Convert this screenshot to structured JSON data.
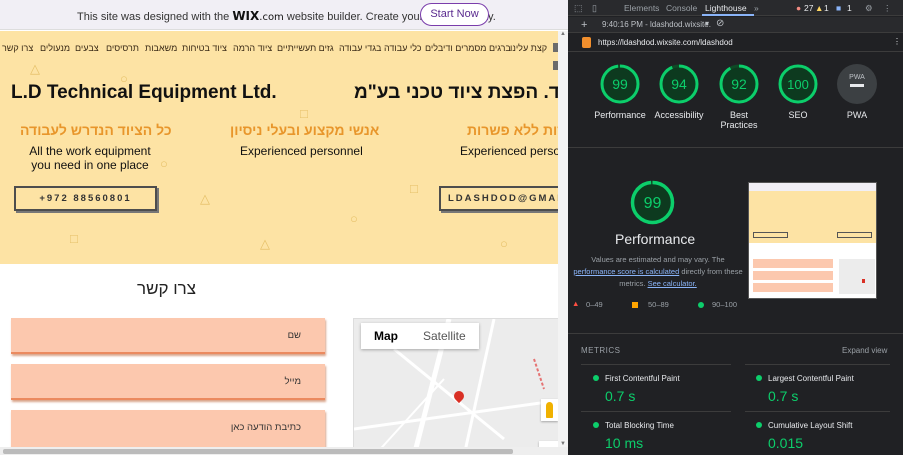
{
  "wix_banner": {
    "message_pre": "This site was designed with the",
    "brand": "WIX",
    "brand_suffix": ".com",
    "message_post": "website builder. Create your website today.",
    "cta": "Start Now"
  },
  "site": {
    "nav_items": [
      "צרו קשר",
      "מנעולים",
      "צבעים",
      "תרסיסים",
      "משאבות",
      "ציוד בטיחות",
      "ציוד הרמה",
      "גזים תעשייתיים",
      "בגדי עבודה",
      "כלי עבודה",
      "ברגים מסמרים ודיבלים",
      "קצת עלינו"
    ],
    "title_en": "L.D Technical Equipment Ltd.",
    "title_he": "ל.ד. הפצת ציוד טכני בע\"מ",
    "columns": [
      {
        "heading": "כל הציוד הנדרש לעבודה",
        "text_line1": "All the work equipment",
        "text_line2": "you need in one place"
      },
      {
        "heading": "אנשי מקצוע ובעלי ניסיון",
        "text_line1": "Experienced personnel",
        "text_line2": ""
      },
      {
        "heading": "שירות ללא פשרות",
        "text_line1": "Experienced personn",
        "text_line2": ""
      }
    ],
    "phone_button": "+972 88560801",
    "email_button": "LDASHDOD@GMAIL.CO",
    "contact_title": "צרו קשר",
    "form_fields": [
      "שם",
      "מייל",
      "כתיבת הודעה כאן"
    ],
    "map": {
      "tab_map": "Map",
      "tab_satellite": "Satellite"
    }
  },
  "devtools": {
    "tabs": [
      "Elements",
      "Console",
      "Lighthouse"
    ],
    "active_tab": "Lighthouse",
    "warnings": {
      "errors": "27",
      "warnings": "1",
      "messages": "1"
    },
    "report_select": "9:40:16 PM - ldashdod.wixsite.",
    "url": "https://ldashdod.wixsite.com/ldashdod",
    "scores": [
      {
        "label": "Performance",
        "value": "99"
      },
      {
        "label": "Accessibility",
        "value": "94"
      },
      {
        "label": "Best Practices",
        "value": "92"
      },
      {
        "label": "SEO",
        "value": "100"
      },
      {
        "label": "PWA",
        "value": "PWA"
      }
    ],
    "performance": {
      "score": "99",
      "title": "Performance",
      "note_pre": "Values are estimated and may vary. The",
      "note_link1": "performance score is calculated",
      "note_mid": "directly from these metrics.",
      "note_link2": "See calculator.",
      "legend": [
        "0–49",
        "50–89",
        "90–100"
      ]
    },
    "metrics_header": "METRICS",
    "expand_view": "Expand view",
    "metrics": [
      {
        "name": "First Contentful Paint",
        "value": "0.7 s"
      },
      {
        "name": "Largest Contentful Paint",
        "value": "0.7 s"
      },
      {
        "name": "Total Blocking Time",
        "value": "10 ms"
      },
      {
        "name": "Cumulative Layout Shift",
        "value": "0.015"
      }
    ],
    "colors": {
      "pass": "#0cce6b",
      "average": "#ffa400",
      "fail": "#ff4e42"
    }
  }
}
